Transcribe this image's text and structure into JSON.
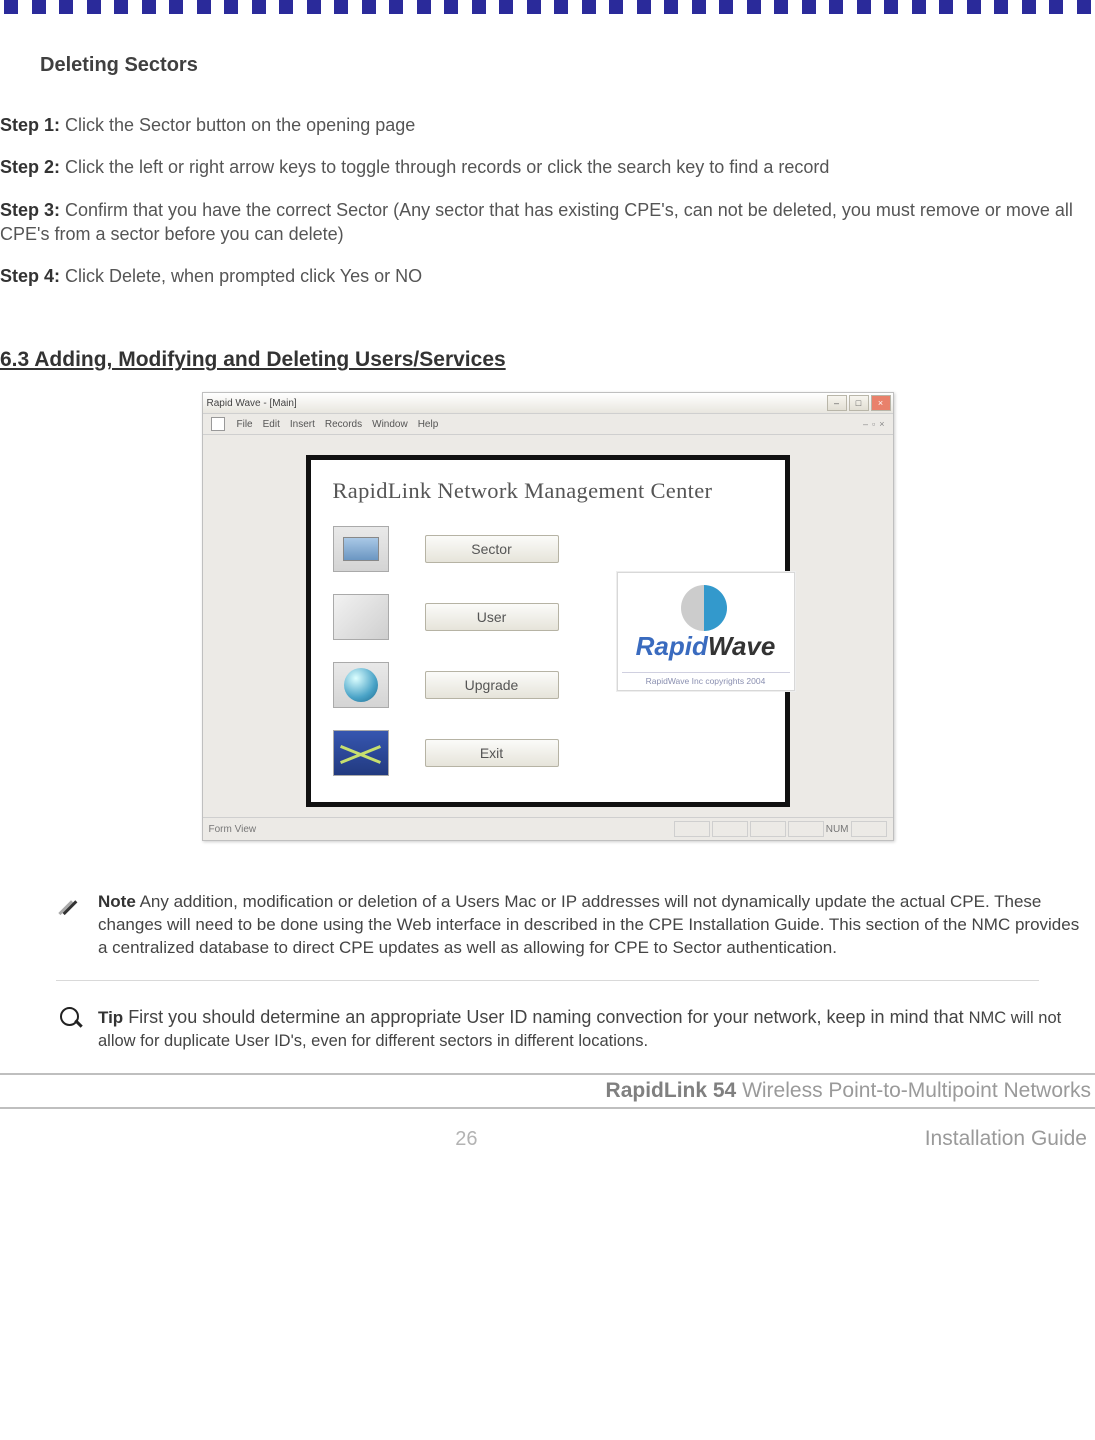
{
  "header": {
    "section_title": "Deleting Sectors"
  },
  "steps": {
    "s1_label": "Step 1:",
    "s1_text": " Click the Sector button on the opening page",
    "s2_label": "Step 2:",
    "s2_text": " Click the left or right arrow keys to toggle through records or click the search key to find a record",
    "s3_label": "Step 3:",
    "s3_text": " Confirm that you have the correct Sector (Any sector that has existing CPE's, can not be deleted, you must remove or move all CPE's from a sector before you can delete)",
    "s4_label": "Step 4:",
    "s4_text": " Click Delete, when prompted click Yes or NO"
  },
  "subheading": "6.3 Adding, Modifying and Deleting Users/Services",
  "app": {
    "title": "Rapid Wave - [Main]",
    "menus": {
      "file": "File",
      "edit": "Edit",
      "insert": "Insert",
      "records": "Records",
      "window": "Window",
      "help": "Help"
    },
    "panel_title": "RapidLink Network Management Center",
    "buttons": {
      "sector": "Sector",
      "user": "User",
      "upgrade": "Upgrade",
      "exit": "Exit"
    },
    "logo": {
      "prefix": "Rapid",
      "suffix": "Wave",
      "copyright": "RapidWave Inc copyrights 2004"
    },
    "status": {
      "left": "Form View",
      "right": "NUM"
    },
    "mdi": {
      "dash": "–",
      "dot": "·"
    }
  },
  "note": {
    "label": "Note",
    "text": " Any addition, modification or deletion of a Users Mac or IP addresses will not dynamically update the actual CPE. These changes will need to be done using the Web interface in described in the CPE Installation Guide.  This section of the NMC provides a centralized database to direct CPE updates as well as allowing for CPE to Sector authentication."
  },
  "tip": {
    "label": "Tip",
    "lead": " First you should determine an appropriate User ID naming convection for your network, keep in mind that ",
    "tail": "NMC will not allow for duplicate User ID's, even for different sectors in different locations."
  },
  "footer": {
    "brand_bold": "RapidLink 54",
    "brand_rest": " Wireless Point-to-Multipoint Networks",
    "page_number": "26",
    "doc_title": "Installation Guide"
  }
}
